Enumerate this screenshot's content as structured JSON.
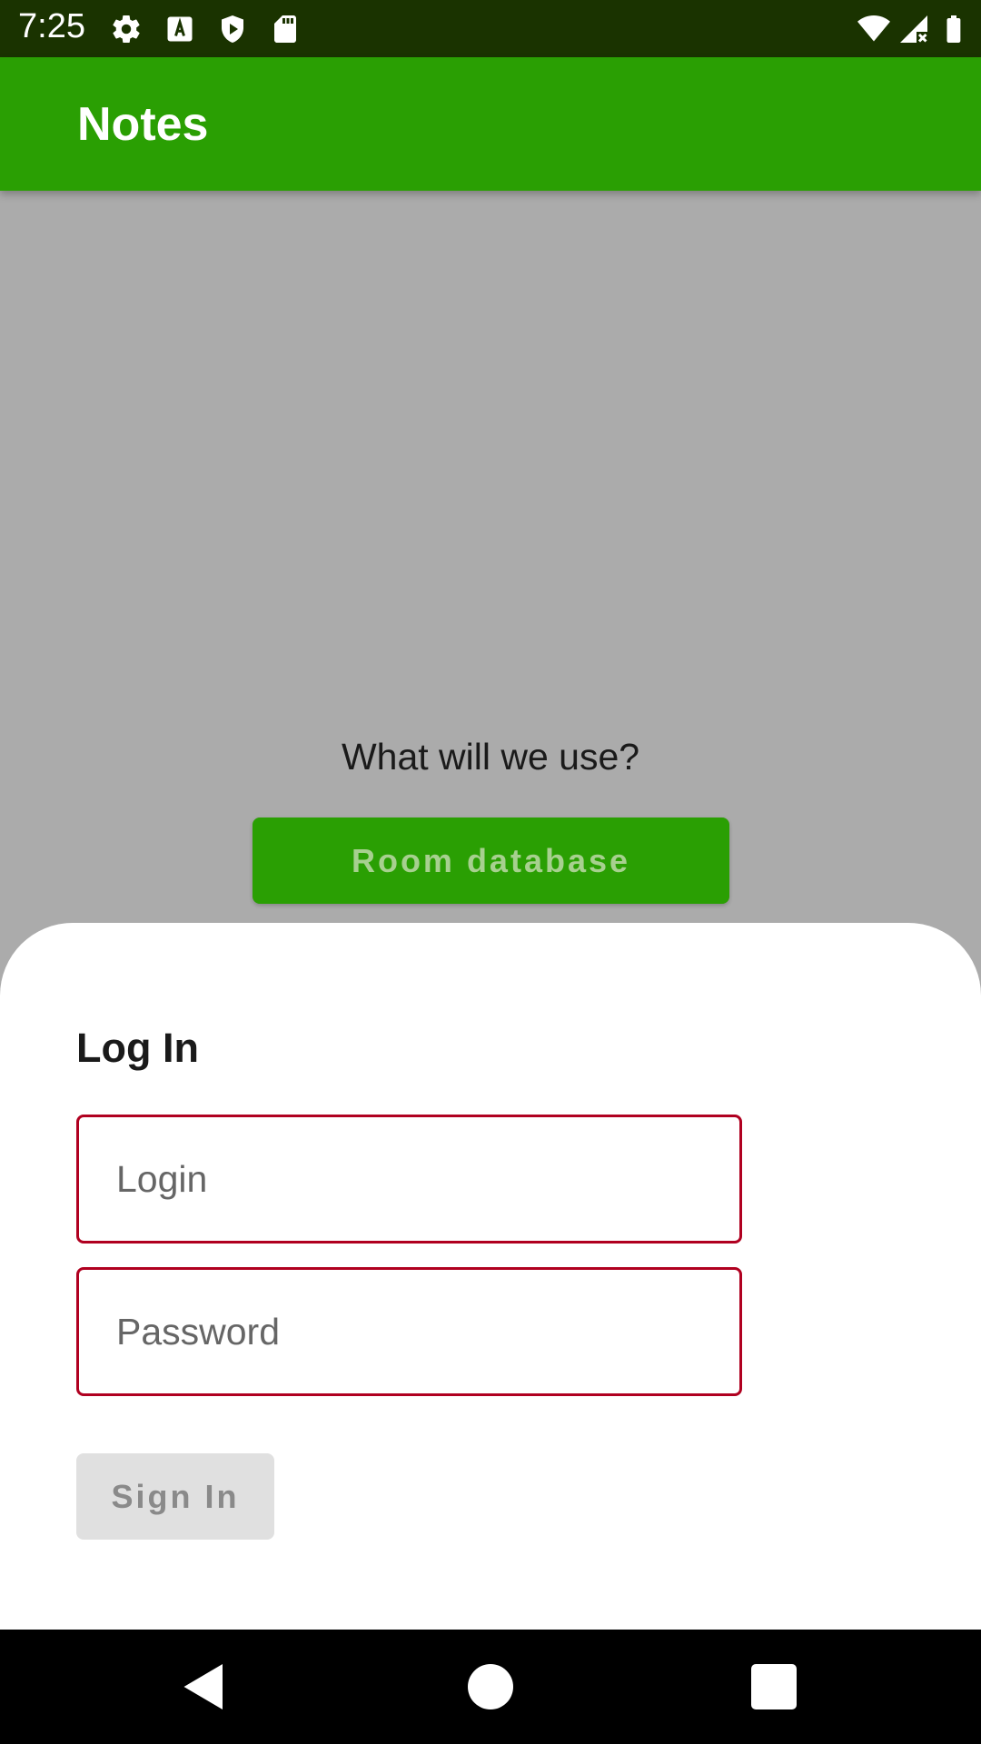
{
  "status_bar": {
    "time": "7:25",
    "left_icons": [
      "gear-icon",
      "font-a-icon",
      "shield-play-icon",
      "sd-card-icon"
    ],
    "right_icons": [
      "wifi-icon",
      "signal-off-icon",
      "battery-icon"
    ]
  },
  "app_bar": {
    "title": "Notes",
    "color": "#2a9f03"
  },
  "main": {
    "question": "What will we use?",
    "room_button_label": "Room database"
  },
  "login_sheet": {
    "title": "Log In",
    "login_placeholder": "Login",
    "password_placeholder": "Password",
    "sign_in_label": "Sign In",
    "error_color": "#b00020"
  },
  "nav_bar": {
    "buttons": [
      "back-icon",
      "home-icon",
      "recents-icon"
    ]
  }
}
